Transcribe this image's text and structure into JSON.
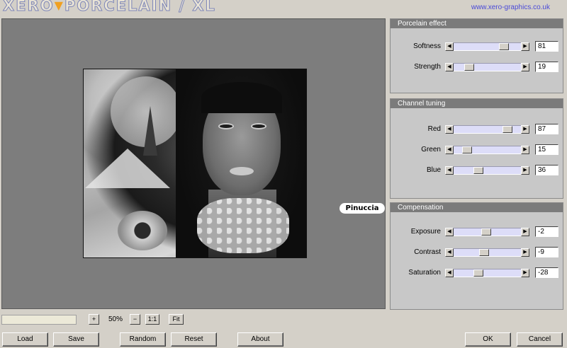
{
  "header": {
    "logo_left": "XERO",
    "logo_right": "PORCELAIN / XL",
    "site_url": "www.xero-graphics.co.uk"
  },
  "preview": {
    "signature": "Pinuccia"
  },
  "panels": {
    "porcelain_effect": {
      "title": "Porcelain effect",
      "sliders": [
        {
          "label": "Softness",
          "value": "81",
          "level": 0.81
        },
        {
          "label": "Strength",
          "value": "19",
          "level": 0.19
        }
      ]
    },
    "channel_tuning": {
      "title": "Channel tuning",
      "sliders": [
        {
          "label": "Red",
          "value": "87",
          "level": 0.87
        },
        {
          "label": "Green",
          "value": "15",
          "level": 0.15
        },
        {
          "label": "Blue",
          "value": "36",
          "level": 0.36
        }
      ]
    },
    "compensation": {
      "title": "Compensation",
      "sliders": [
        {
          "label": "Exposure",
          "value": "-2",
          "level": 0.49
        },
        {
          "label": "Contrast",
          "value": "-9",
          "level": 0.455
        },
        {
          "label": "Saturation",
          "value": "-28",
          "level": 0.36
        }
      ]
    }
  },
  "zoom": {
    "plus": "+",
    "level": "50%",
    "minus": "−",
    "one_to_one": "1:1",
    "fit": "Fit"
  },
  "buttons": {
    "load": "Load",
    "save": "Save",
    "random": "Random",
    "reset": "Reset",
    "about": "About",
    "ok": "OK",
    "cancel": "Cancel"
  },
  "icons": {
    "slider_left": "arrow-left-icon",
    "slider_right": "arrow-right-icon"
  },
  "colors": {
    "panel_title_bg": "#7b7b7b",
    "track": "#ddddf8",
    "url": "#4a4ad8"
  }
}
